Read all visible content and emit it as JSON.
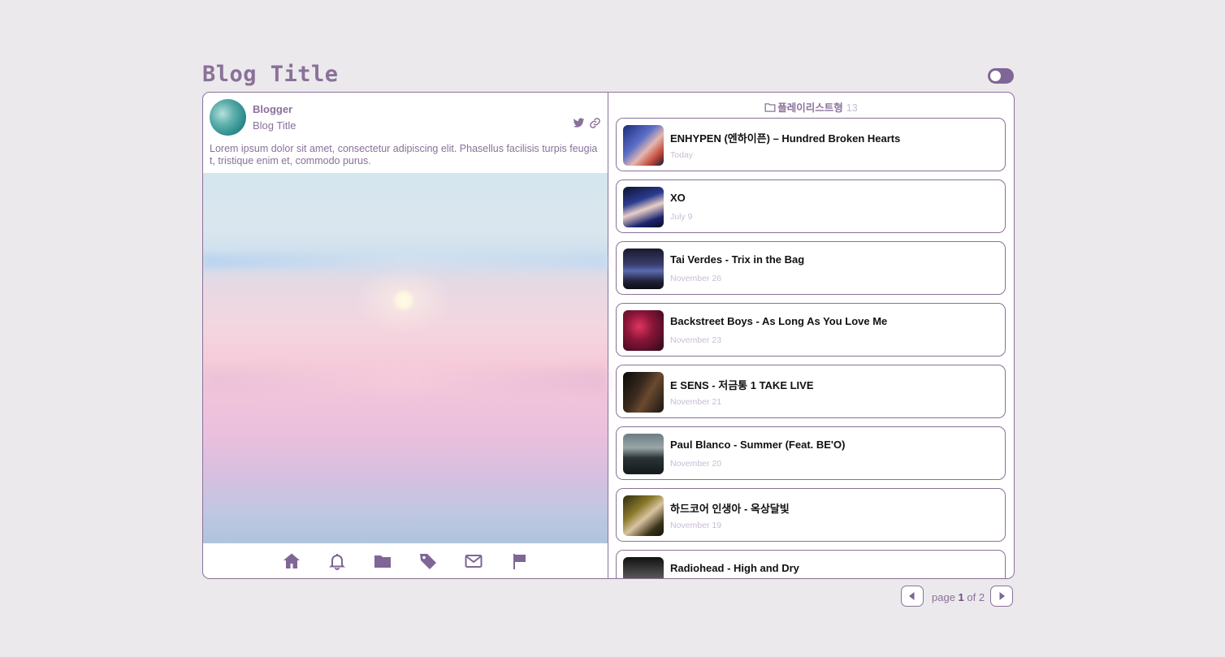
{
  "header": {
    "title": "Blog Title"
  },
  "profile": {
    "name": "Blogger",
    "subtitle": "Blog Title",
    "description": "Lorem ipsum dolor sit amet, consectetur adipiscing elit. Phasellus facilisis turpis feugiat, tristique enim et, commodo purus."
  },
  "playlist": {
    "folder_name": "플레이리스트형",
    "count": "13",
    "items": [
      {
        "title": "ENHYPEN (엔하이픈) – Hundred Broken Hearts",
        "date": "Today"
      },
      {
        "title": "XO",
        "date": "July 9"
      },
      {
        "title": "Tai Verdes - Trix in the Bag",
        "date": "November 26"
      },
      {
        "title": "Backstreet Boys - As Long As You Love Me",
        "date": "November 23"
      },
      {
        "title": "E SENS - 저금통 1 TAKE LIVE",
        "date": "November 21"
      },
      {
        "title": "Paul Blanco - Summer (Feat. BE'O)",
        "date": "November 20"
      },
      {
        "title": "하드코어 인생아 - 옥상달빛",
        "date": "November 19"
      },
      {
        "title": "Radiohead - High and Dry",
        "date": ""
      }
    ]
  },
  "pager": {
    "label": "page",
    "current": "1",
    "of": "of",
    "total": "2"
  },
  "colors": {
    "accent": "#8a7199",
    "muted": "#c9bcd6",
    "background": "#ebe9ec"
  }
}
